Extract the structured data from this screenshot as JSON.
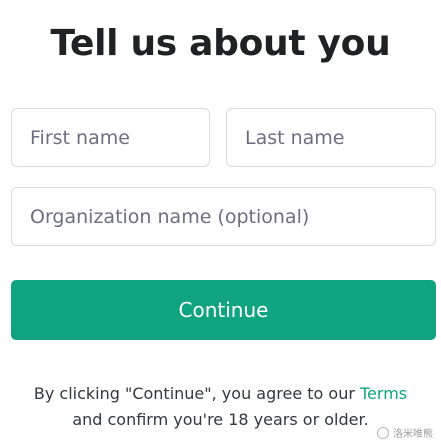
{
  "page": {
    "title": "Tell us about you"
  },
  "form": {
    "first_name_placeholder": "First name",
    "last_name_placeholder": "Last name",
    "organization_placeholder": "Organization name (optional)",
    "first_name_value": "",
    "last_name_value": "",
    "organization_value": ""
  },
  "actions": {
    "continue_label": "Continue"
  },
  "legal": {
    "line1_text": "By clicking \"Continue\", you agree to our ",
    "terms_link": "Terms",
    "line2_text": "and confirm you're 18 years or older."
  },
  "watermark": {
    "text": "洛米唯熊"
  },
  "colors": {
    "accent": "#10a37f",
    "text": "#202123",
    "placeholder": "#6e6e80",
    "border": "#d9d9e3"
  }
}
